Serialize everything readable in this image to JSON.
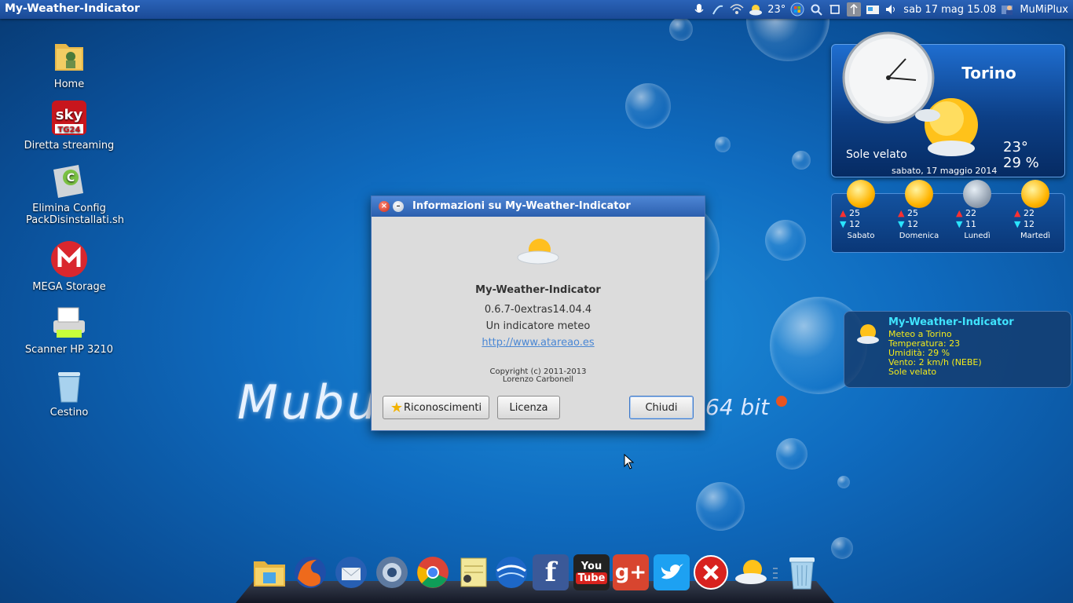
{
  "top_panel": {
    "app_title": "My-Weather-Indicator",
    "temperature": "23°",
    "clock": "sab 17 mag 15.08",
    "user": "MuMiPlux",
    "icons": [
      "microphone-icon",
      "network-icon",
      "wireless-icon",
      "weather-icon",
      "windows-icon",
      "search-icon",
      "screenshot-icon",
      "update-icon",
      "notes-icon",
      "volume-icon",
      "user-icon"
    ]
  },
  "desktop_icons": [
    {
      "label": "Home",
      "icon": "home-folder-icon"
    },
    {
      "label": "Diretta streaming",
      "icon": "sky-tg24-icon"
    },
    {
      "label": "Elimina Config PackDisinstallati.sh",
      "icon": "cleaner-icon"
    },
    {
      "label": "MEGA Storage",
      "icon": "mega-icon"
    },
    {
      "label": "Scanner HP 3210",
      "icon": "scanner-icon"
    },
    {
      "label": "Cestino",
      "icon": "trash-icon"
    }
  ],
  "desktop_logo": {
    "text": "Mubur",
    "suffix": "64 bit"
  },
  "weather_widget": {
    "city": "Torino",
    "condition": "Sole velato",
    "temperature": "23°",
    "humidity": "29 %",
    "date": "sabato, 17 maggio 2014"
  },
  "forecast": [
    {
      "day": "Sabato",
      "high": "25",
      "low": "12",
      "icon": "sun"
    },
    {
      "day": "Domenica",
      "high": "25",
      "low": "12",
      "icon": "sun"
    },
    {
      "day": "Lunedì",
      "high": "22",
      "low": "11",
      "icon": "cloud"
    },
    {
      "day": "Martedì",
      "high": "22",
      "low": "12",
      "icon": "sun"
    }
  ],
  "notification": {
    "title": "My-Weather-Indicator",
    "line1": "Meteo a Torino",
    "line2": "Temperatura: 23",
    "line3": "Umidità: 29 %",
    "line4": "Vento: 2 km/h (NEBE)",
    "line5": "Sole velato"
  },
  "dialog": {
    "title": "Informazioni su My-Weather-Indicator",
    "app_name": "My-Weather-Indicator",
    "version": "0.6.7-0extras14.04.4",
    "description": "Un indicatore meteo",
    "link": "http://www.atareao.es",
    "copyright": "Copyright (c) 2011-2013",
    "author": "Lorenzo Carbonell",
    "credits_button": "Riconoscimenti",
    "license_button": "Licenza",
    "close_button": "Chiudi"
  },
  "dock": {
    "items": [
      "files-icon",
      "firefox-icon",
      "thunderbird-icon",
      "browser-icon",
      "chrome-icon",
      "notes-icon",
      "google-earth-icon",
      "facebook-icon",
      "youtube-icon",
      "google-plus-icon",
      "twitter-icon",
      "close-app-icon",
      "weather-icon",
      "trash-icon"
    ],
    "youtube_label_1": "You",
    "youtube_label_2": "Tube",
    "facebook_label": "f",
    "gplus_label": "g+"
  }
}
